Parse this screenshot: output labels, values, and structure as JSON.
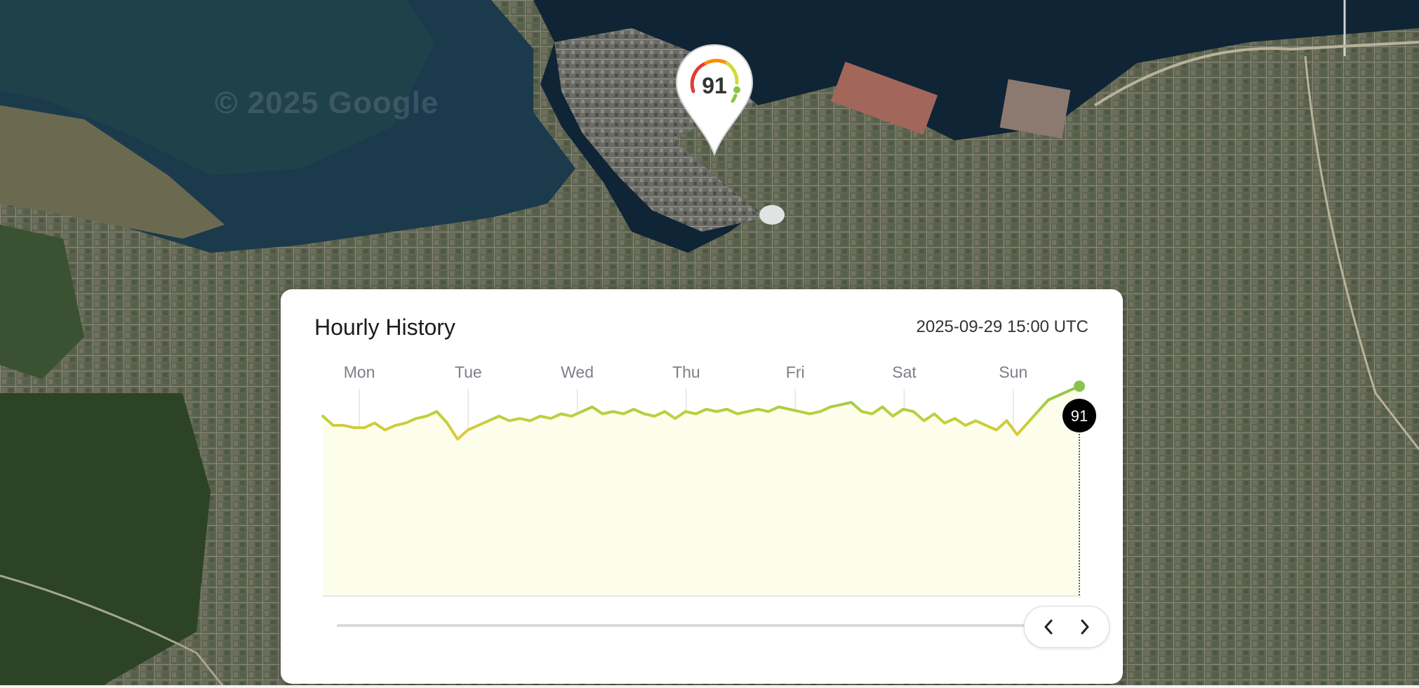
{
  "map": {
    "watermark": "© 2025 Google",
    "marker_value": "91"
  },
  "panel": {
    "title": "Hourly History",
    "timestamp": "2025-09-29 15:00 UTC",
    "current_badge": "91",
    "colors": {
      "good": "#8bc34a",
      "moderate": "#e6c936",
      "fill": "#fdfdec",
      "badge": "#000000"
    }
  },
  "chart_data": {
    "type": "line",
    "categories": [
      "Mon",
      "Tue",
      "Wed",
      "Thu",
      "Fri",
      "Sat",
      "Sun"
    ],
    "ylim": [
      0,
      100
    ],
    "grid": "vertical",
    "series": [
      {
        "values": [
          78,
          74,
          74,
          73,
          73,
          75,
          72,
          74,
          75,
          77,
          78,
          80,
          75,
          68,
          72,
          74,
          76,
          78,
          76,
          77,
          76,
          78,
          77,
          79,
          78,
          80,
          82,
          79,
          80,
          79,
          81,
          79,
          78,
          80,
          77,
          80,
          79,
          81,
          80,
          81,
          79,
          80,
          81,
          80,
          82,
          81,
          80,
          79,
          80,
          82,
          83,
          84,
          80,
          79,
          82,
          78,
          81,
          80,
          76,
          79,
          75,
          77,
          74,
          76,
          74,
          72,
          76,
          70,
          75,
          80,
          85,
          87,
          89,
          91
        ]
      }
    ],
    "current_value": 91
  },
  "nav": {
    "prev_icon": "chevron-left-icon",
    "next_icon": "chevron-right-icon"
  }
}
